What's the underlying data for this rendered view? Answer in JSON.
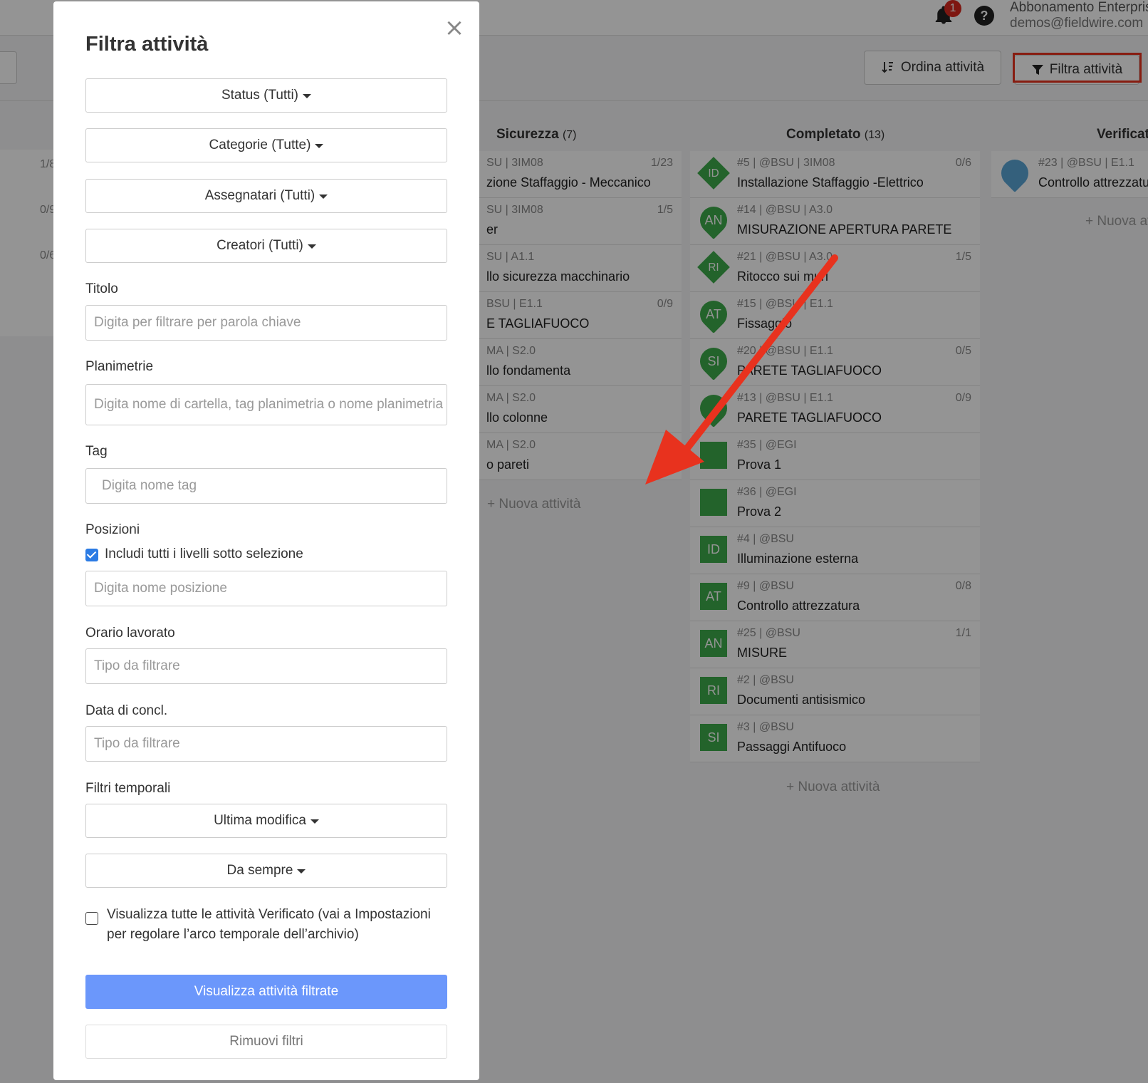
{
  "header": {
    "notifications_count": "1",
    "help_label": "?",
    "account_name": "Abbonamento Enterprise",
    "account_email": "demos@fieldwire.com"
  },
  "toolbar": {
    "sort_label": "Ordina attività",
    "filter_label": "Filtra attività"
  },
  "columns": {
    "left_progress": [
      "1/8",
      "0/9",
      "0/6"
    ],
    "sicurezza": {
      "name": "Sicurezza",
      "count": "(7)",
      "cards": [
        {
          "meta": "SU | 3IM08",
          "title": "zione Staffaggio - Meccanico",
          "progress": "1/23"
        },
        {
          "meta": "SU | 3IM08",
          "title": "er",
          "progress": "1/5"
        },
        {
          "meta": "SU | A1.1",
          "title": "llo sicurezza macchinario",
          "progress": ""
        },
        {
          "meta": "BSU | E1.1",
          "title": "E TAGLIAFUOCO",
          "progress": "0/9"
        },
        {
          "meta": "MA | S2.0",
          "title": "llo fondamenta",
          "progress": ""
        },
        {
          "meta": "MA | S2.0",
          "title": "llo colonne",
          "progress": ""
        },
        {
          "meta": "MA | S2.0",
          "title": "o pareti",
          "progress": ""
        }
      ],
      "new_label": "+ Nuova attività"
    },
    "completato": {
      "name": "Completato",
      "count": "(13)",
      "cards": [
        {
          "icon": "ID",
          "shape": "diamond",
          "meta": "#5 | @BSU | 3IM08",
          "title": "Installazione Staffaggio -Elettrico",
          "progress": "0/6"
        },
        {
          "icon": "AN",
          "shape": "pin",
          "meta": "#14 | @BSU | A3.0",
          "title": "MISURAZIONE APERTURA PARETE",
          "progress": ""
        },
        {
          "icon": "RI",
          "shape": "diamond",
          "meta": "#21 | @BSU | A3.0",
          "title": "Ritocco sui muri",
          "progress": "1/5"
        },
        {
          "icon": "AT",
          "shape": "pin",
          "meta": "#15 | @BSU | E1.1",
          "title": "Fissaggio",
          "progress": ""
        },
        {
          "icon": "SI",
          "shape": "pin",
          "meta": "#20 | @BSU | E1.1",
          "title": "PARETE TAGLIAFUOCO",
          "progress": "0/5"
        },
        {
          "icon": "",
          "shape": "pin",
          "meta": "#13 | @BSU | E1.1",
          "title": "PARETE TAGLIAFUOCO",
          "progress": "0/9"
        },
        {
          "icon": "",
          "shape": "sq",
          "meta": "#35 | @EGI",
          "title": "Prova 1",
          "progress": ""
        },
        {
          "icon": "",
          "shape": "sq",
          "meta": "#36 | @EGI",
          "title": "Prova 2",
          "progress": ""
        },
        {
          "icon": "ID",
          "shape": "sq",
          "meta": "#4 | @BSU",
          "title": "Illuminazione esterna",
          "progress": ""
        },
        {
          "icon": "AT",
          "shape": "sq",
          "meta": "#9 | @BSU",
          "title": "Controllo attrezzatura",
          "progress": "0/8"
        },
        {
          "icon": "AN",
          "shape": "sq",
          "meta": "#25 | @BSU",
          "title": "MISURE",
          "progress": "1/1"
        },
        {
          "icon": "RI",
          "shape": "sq",
          "meta": "#2 | @BSU",
          "title": "Documenti antisismico",
          "progress": ""
        },
        {
          "icon": "SI",
          "shape": "sq",
          "meta": "#3 | @BSU",
          "title": "Passaggi Antifuoco",
          "progress": ""
        }
      ],
      "new_label": "+ Nuova attività"
    },
    "verificato": {
      "name": "Verificato",
      "cards": [
        {
          "meta": "#23 | @BSU | E1.1",
          "title": "Controllo attrezzatura"
        }
      ],
      "new_label": "+ Nuova attività"
    }
  },
  "modal": {
    "title": "Filtra attività",
    "close_icon": "close-icon",
    "dropdowns": {
      "status": "Status (Tutti)",
      "categories": "Categorie (Tutte)",
      "assignees": "Assegnatari (Tutti)",
      "creators": "Creatori (Tutti)"
    },
    "fields": {
      "title_label": "Titolo",
      "title_placeholder": "Digita per filtrare per parola chiave",
      "plans_label": "Planimetrie",
      "plans_placeholder": "Digita nome di cartella, tag planimetria o nome planimetria",
      "tag_label": "Tag",
      "tag_placeholder": "Digita nome tag",
      "locations_label": "Posizioni",
      "locations_checkbox": "Includi tutti i livelli sotto selezione",
      "locations_placeholder": "Digita nome posizione",
      "hours_label": "Orario lavorato",
      "hours_placeholder": "Tipo da filtrare",
      "due_label": "Data di concl.",
      "due_placeholder": "Tipo da filtrare",
      "time_filters_label": "Filtri temporali",
      "last_modified": "Ultima modifica",
      "since": "Da sempre",
      "verified_checkbox": "Visualizza tutte le attività Verificato (vai a Impostazioni per regolare l’arco temporale dell’archivio)"
    },
    "apply_label": "Visualizza attività filtrate",
    "remove_label": "Rimuovi filtri"
  },
  "colors": {
    "accent": "#6b97fb",
    "highlight": "#e8321e",
    "status_green": "#3dab4a"
  }
}
